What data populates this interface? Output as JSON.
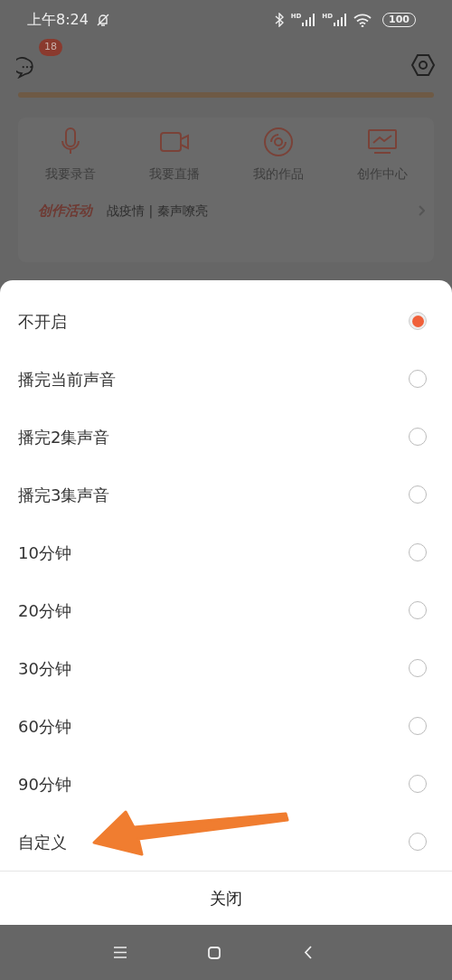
{
  "status_bar": {
    "time": "上午8:24",
    "signals": [
      {
        "label": "HD"
      },
      {
        "label": "HD"
      }
    ],
    "battery": "100"
  },
  "header": {
    "messages_badge": "18"
  },
  "shortcuts": [
    {
      "label": "我要录音",
      "kind": "mic"
    },
    {
      "label": "我要直播",
      "kind": "camera"
    },
    {
      "label": "我的作品",
      "kind": "disc"
    },
    {
      "label": "创作中心",
      "kind": "monitor"
    }
  ],
  "activity": {
    "title": "创作活动",
    "text": "战疫情 | 秦声嘹亮"
  },
  "options": [
    {
      "label": "不开启",
      "selected": true
    },
    {
      "label": "播完当前声音",
      "selected": false
    },
    {
      "label": "播完2集声音",
      "selected": false
    },
    {
      "label": "播完3集声音",
      "selected": false
    },
    {
      "label": "10分钟",
      "selected": false
    },
    {
      "label": "20分钟",
      "selected": false
    },
    {
      "label": "30分钟",
      "selected": false
    },
    {
      "label": "60分钟",
      "selected": false
    },
    {
      "label": "90分钟",
      "selected": false
    },
    {
      "label": "自定义",
      "selected": false
    }
  ],
  "close_button": "关闭"
}
